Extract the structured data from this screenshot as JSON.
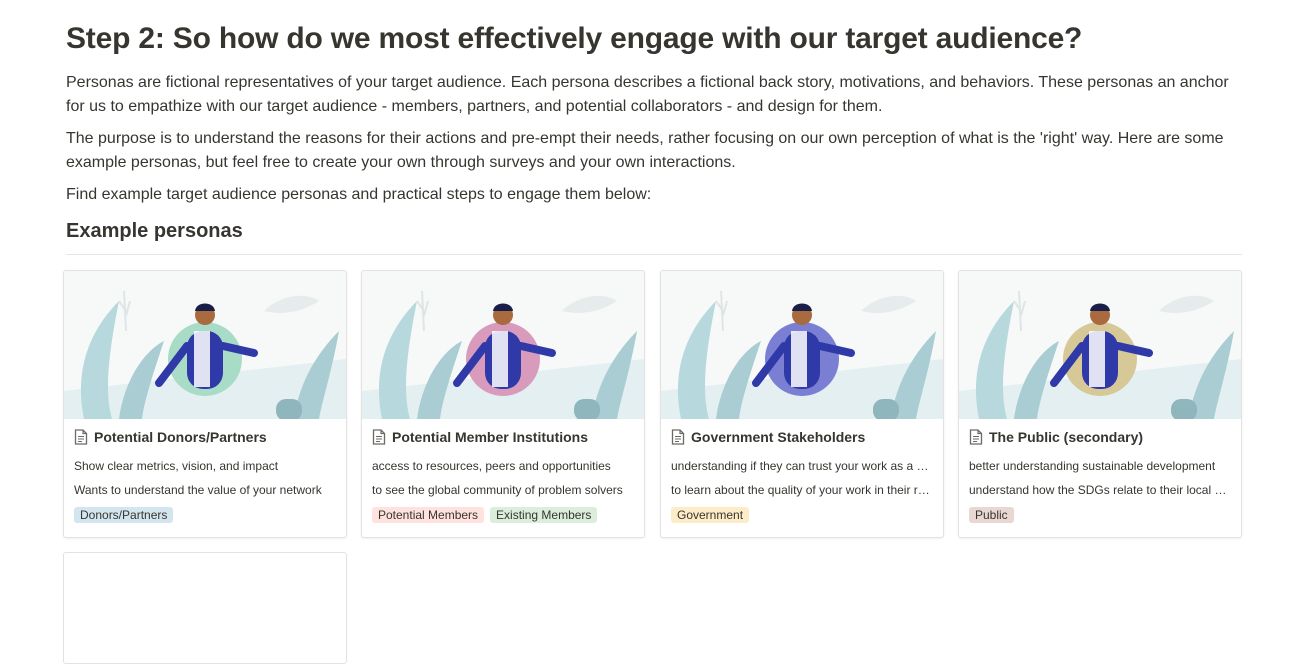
{
  "heading": "Step 2: So how do we most effectively engage with our target audience?",
  "paragraphs": {
    "p1": "Personas are fictional representatives of your target audience. Each persona describes a fictional back story, motivations, and behaviors. These personas an anchor for us to empathize with our target audience - members, partners, and potential collaborators - and design for them.",
    "p2": "The purpose is to understand the reasons for their actions and pre-empt their needs, rather focusing on our own perception of what is the 'right' way. Here are some example personas, but feel free to create your own through surveys and your own interactions.",
    "p3": "Find example target audience personas and practical steps to engage them below:"
  },
  "section_title": "Example personas",
  "gallery": {
    "cards": [
      {
        "title": "Potential Donors/Partners",
        "prop1": "Show clear metrics, vision, and impact",
        "prop2": "Wants to understand the value of your network",
        "tags": [
          {
            "label": "Donors/Partners",
            "color": "#d3e5ef"
          }
        ],
        "circle_color": "#a8dcc6",
        "icon": "page-icon"
      },
      {
        "title": "Potential Member Institutions",
        "prop1": "access to resources, peers and opportunities",
        "prop2": "to see the global community of problem solvers",
        "tags": [
          {
            "label": "Potential Members",
            "color": "#ffe2dd"
          },
          {
            "label": "Existing Members",
            "color": "#dbeddb"
          }
        ],
        "circle_color": "#d99bbc",
        "icon": "page-icon"
      },
      {
        "title": "Government Stakeholders",
        "prop1": "understanding if they can trust your work as a partner",
        "prop2": "to learn about the quality of your work in their region",
        "tags": [
          {
            "label": "Government",
            "color": "#fdecc8"
          }
        ],
        "circle_color": "#7b7fd4",
        "icon": "page-icon"
      },
      {
        "title": "The Public (secondary)",
        "prop1": "better understanding sustainable development",
        "prop2": "understand how the SDGs relate to their local context",
        "tags": [
          {
            "label": "Public",
            "color": "#e9d7d2"
          }
        ],
        "circle_color": "#d6c897",
        "icon": "page-icon"
      }
    ]
  }
}
